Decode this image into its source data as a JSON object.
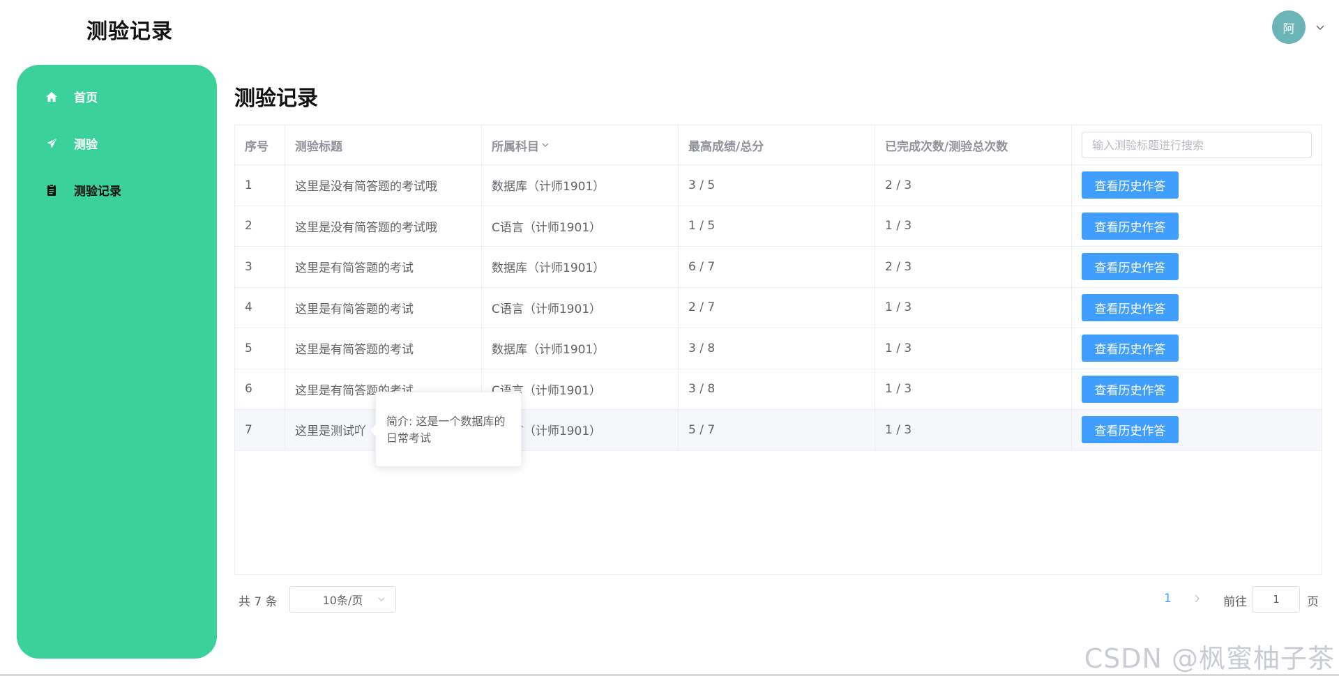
{
  "app": {
    "title": "测验记录"
  },
  "user": {
    "avatar_text": "阿"
  },
  "sidebar": {
    "bg_color": "#3ad19b",
    "items": [
      {
        "label": "首页",
        "icon": "home-icon",
        "active": false
      },
      {
        "label": "测验",
        "icon": "paper-plane-icon",
        "active": false
      },
      {
        "label": "测验记录",
        "icon": "clipboard-icon",
        "active": true
      }
    ]
  },
  "page": {
    "title": "测验记录"
  },
  "table": {
    "columns": [
      "序号",
      "测验标题",
      "所属科目",
      "最高成绩/总分",
      "已完成次数/测验总次数"
    ],
    "search_placeholder": "输入测验标题进行搜索",
    "action_label": "查看历史作答",
    "rows": [
      {
        "index": "1",
        "title": "这里是没有简答题的考试哦",
        "subject": "数据库（计师1901）",
        "score": "3 / 5",
        "attempts": "2 / 3"
      },
      {
        "index": "2",
        "title": "这里是没有简答题的考试哦",
        "subject": "C语言（计师1901）",
        "score": "1 / 5",
        "attempts": "1 / 3"
      },
      {
        "index": "3",
        "title": "这里是有简答题的考试",
        "subject": "数据库（计师1901）",
        "score": "6 / 7",
        "attempts": "2 / 3"
      },
      {
        "index": "4",
        "title": "这里是有简答题的考试",
        "subject": "C语言（计师1901）",
        "score": "2 / 7",
        "attempts": "1 / 3"
      },
      {
        "index": "5",
        "title": "这里是有简答题的考试",
        "subject": "数据库（计师1901）",
        "score": "3 / 8",
        "attempts": "1 / 3"
      },
      {
        "index": "6",
        "title": "这里是有简答题的考试",
        "subject": "C语言（计师1901）",
        "score": "3 / 8",
        "attempts": "1 / 3"
      },
      {
        "index": "7",
        "title": "这里是测试吖",
        "subject": "C语言（计师1901）",
        "score": "5 / 7",
        "attempts": "1 / 3"
      }
    ]
  },
  "tooltip": {
    "text": "简介: 这是一个数据库的日常考试"
  },
  "pagination": {
    "total_text": "共 7 条",
    "page_size": "10条/页",
    "current_page": "1",
    "goto_label": "前往",
    "goto_value": "1",
    "page_unit": "页"
  },
  "watermark": "CSDN @枫蜜柚子茶",
  "colors": {
    "primary": "#409eff",
    "sidebar": "#3ad19b",
    "avatar": "#6bb5b8"
  }
}
